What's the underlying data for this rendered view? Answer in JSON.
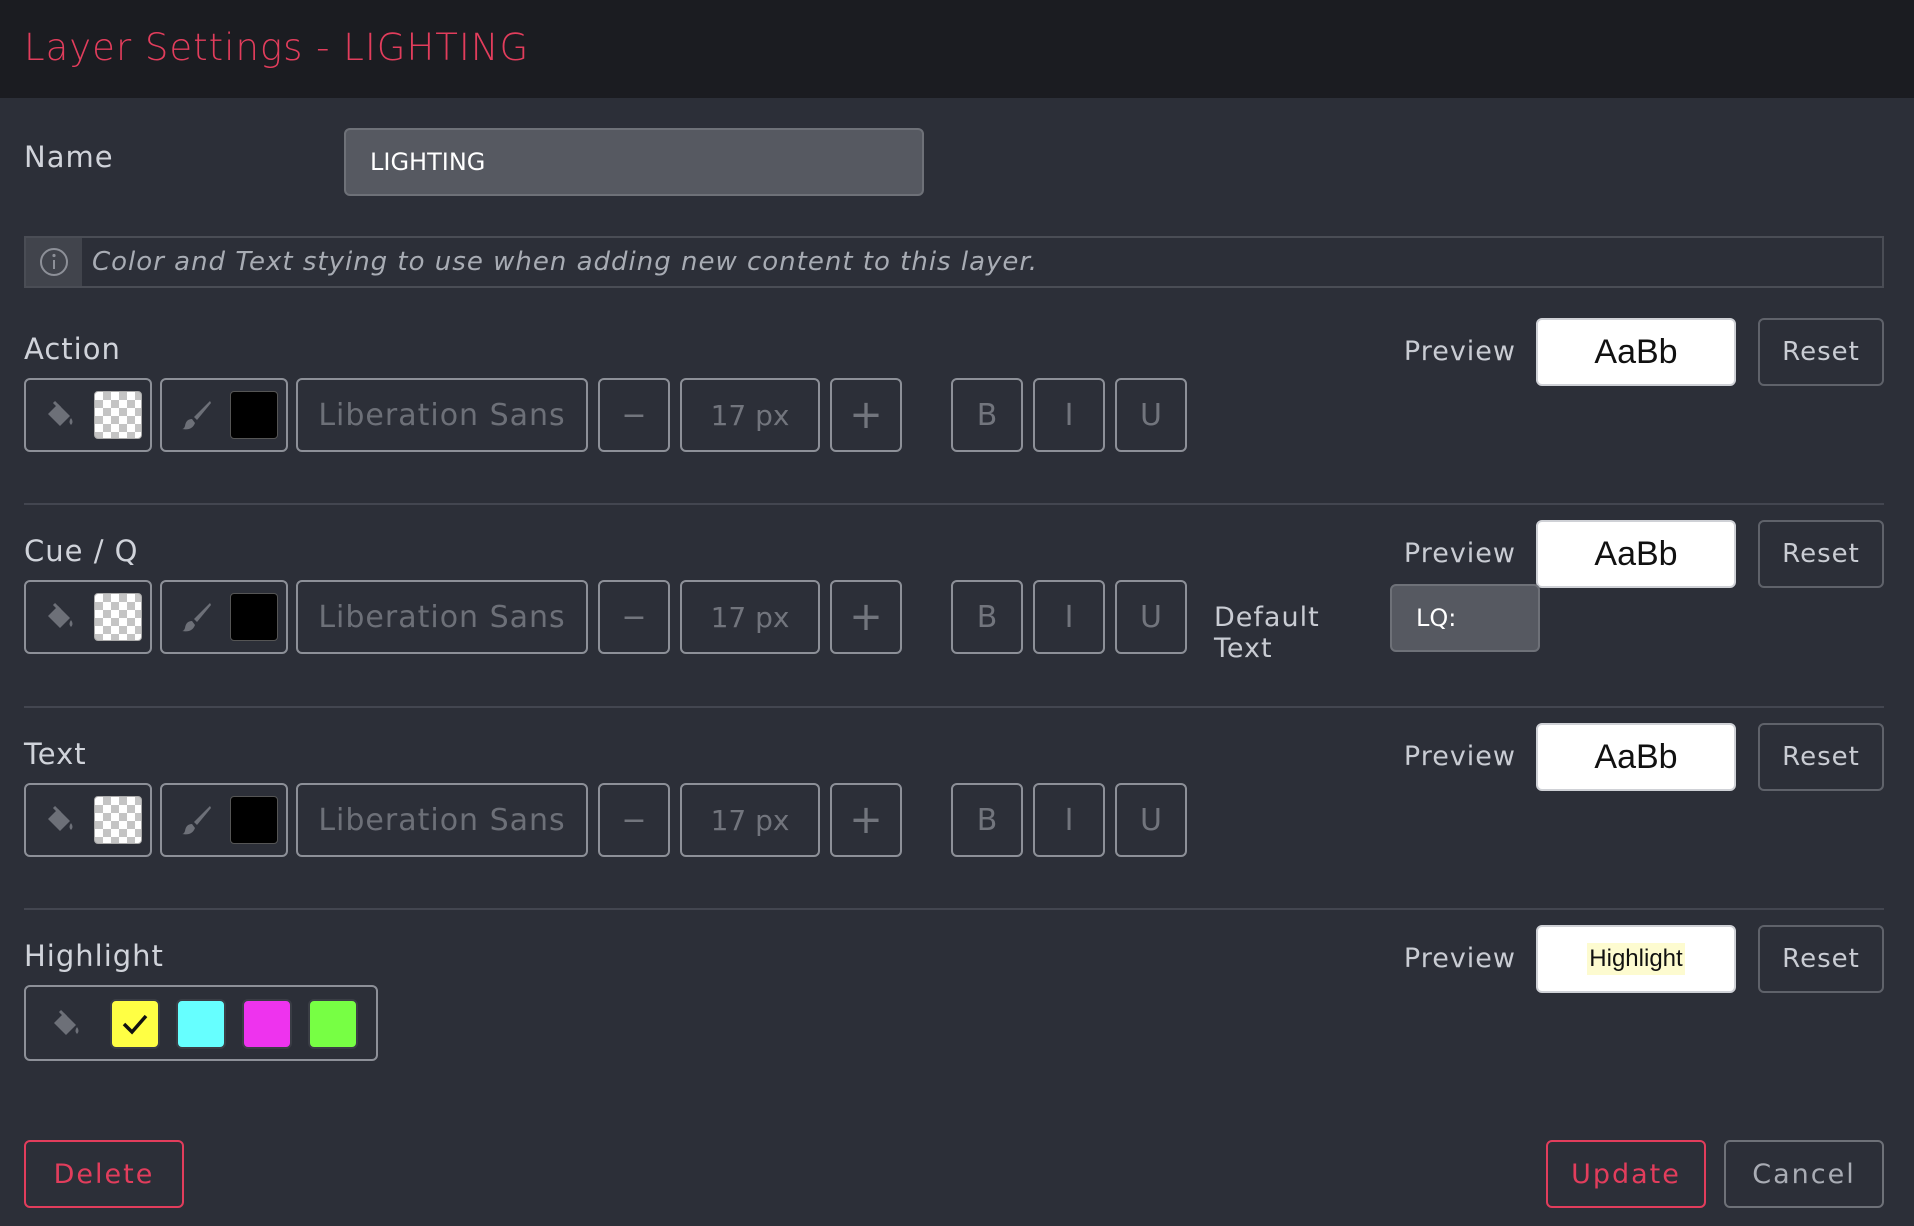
{
  "window": {
    "title": "Layer Settings - LIGHTING"
  },
  "name_field": {
    "label": "Name",
    "value": "LIGHTING"
  },
  "info": {
    "icon": "info-icon",
    "text": "Color and Text stying to use when adding new content to this layer."
  },
  "sections": {
    "action": {
      "label": "Action",
      "preview_label": "Preview",
      "preview_text": "AaBb",
      "reset_label": "Reset",
      "font": "Liberation Sans",
      "size": "17 px",
      "minus": "−",
      "plus": "+",
      "bold": "B",
      "italic": "I",
      "underline": "U"
    },
    "cue": {
      "label": "Cue / Q",
      "preview_label": "Preview",
      "preview_text": "AaBb",
      "reset_label": "Reset",
      "font": "Liberation Sans",
      "size": "17 px",
      "minus": "−",
      "plus": "+",
      "bold": "B",
      "italic": "I",
      "underline": "U",
      "default_text_label": "Default Text",
      "default_text_value": "LQ:"
    },
    "text": {
      "label": "Text",
      "preview_label": "Preview",
      "preview_text": "AaBb",
      "reset_label": "Reset",
      "font": "Liberation Sans",
      "size": "17 px",
      "minus": "−",
      "plus": "+",
      "bold": "B",
      "italic": "I",
      "underline": "U"
    },
    "highlight": {
      "label": "Highlight",
      "preview_label": "Preview",
      "preview_text": "Highlight",
      "reset_label": "Reset",
      "colors": [
        "#ffff44",
        "#66ffff",
        "#ee33ee",
        "#77ff44"
      ],
      "selected_index": 0
    }
  },
  "footer": {
    "delete_label": "Delete",
    "update_label": "Update",
    "cancel_label": "Cancel"
  },
  "colors": {
    "accent": "#e23d5c",
    "background": "#2c2f38",
    "titlebar": "#1b1c21"
  }
}
